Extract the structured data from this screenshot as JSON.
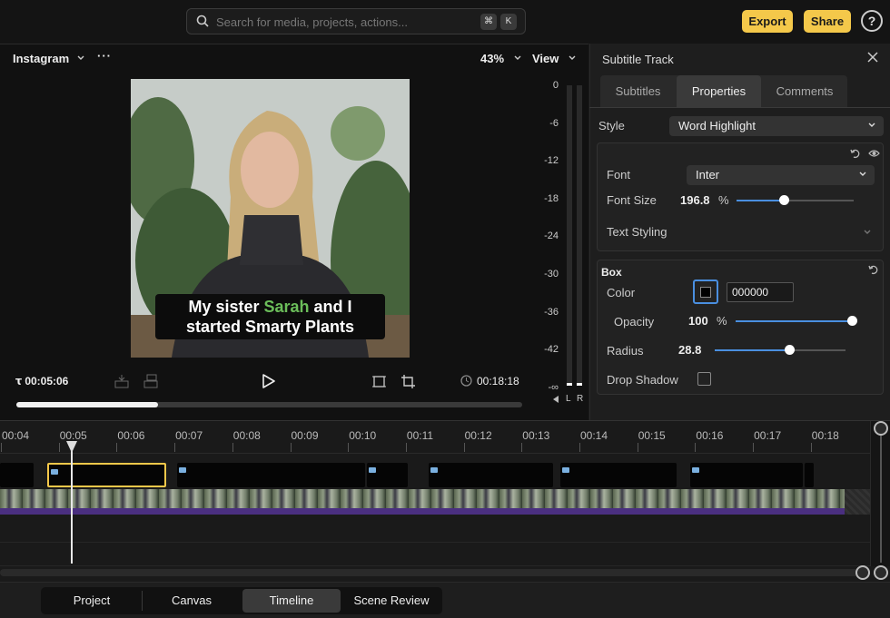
{
  "topbar": {
    "search_placeholder": "Search for media, projects, actions...",
    "shortcut_keys": [
      "⌘",
      "K"
    ],
    "export_label": "Export",
    "share_label": "Share",
    "help_label": "?"
  },
  "preview": {
    "preset": "Instagram",
    "more_label": "···",
    "zoom": "43%",
    "view_label": "View",
    "caption_before": "My sister ",
    "caption_highlight": "Sarah",
    "caption_after": " and I",
    "caption_line2": "started Smarty Plants",
    "highlight_color": "#6bbd5a",
    "current_time": "00:05:06",
    "duration": "00:18:18",
    "playback_progress": 0.28,
    "meter": {
      "db_labels": [
        "0",
        "-6",
        "-12",
        "-18",
        "-24",
        "-30",
        "-36",
        "-42",
        "-∞"
      ],
      "channel_left": "L",
      "channel_right": "R"
    }
  },
  "panel": {
    "title": "Subtitle Track",
    "tabs": [
      {
        "label": "Subtitles",
        "active": false
      },
      {
        "label": "Properties",
        "active": true
      },
      {
        "label": "Comments",
        "active": false
      }
    ],
    "style_label": "Style",
    "style_value": "Word Highlight",
    "font_label": "Font",
    "font_value": "Inter",
    "font_size_label": "Font Size",
    "font_size_value": "196.8",
    "font_size_unit": "%",
    "font_size_fraction": 0.4,
    "text_styling_label": "Text Styling",
    "box": {
      "title": "Box",
      "color_label": "Color",
      "color_hex": "000000",
      "opacity_label": "Opacity",
      "opacity_value": "100",
      "opacity_unit": "%",
      "opacity_fraction": 1.0,
      "radius_label": "Radius",
      "radius_value": "28.8",
      "radius_fraction": 0.57,
      "drop_shadow_label": "Drop Shadow",
      "drop_shadow_checked": false
    },
    "accent_color": "#4a8fe0"
  },
  "timeline": {
    "ticks": [
      "00:04",
      "00:05",
      "00:06",
      "00:07",
      "00:08",
      "00:09",
      "00:10",
      "00:11",
      "00:12",
      "00:13",
      "00:14",
      "00:15",
      "00:16",
      "00:17",
      "00:18"
    ],
    "selected_color": "#f4c84a",
    "audio_color": "#4a2f80"
  },
  "bottom": {
    "modes": [
      {
        "label": "Project",
        "active": false
      },
      {
        "label": "Canvas",
        "active": false
      },
      {
        "label": "Timeline",
        "active": true
      },
      {
        "label": "Scene Review",
        "active": false
      }
    ]
  }
}
